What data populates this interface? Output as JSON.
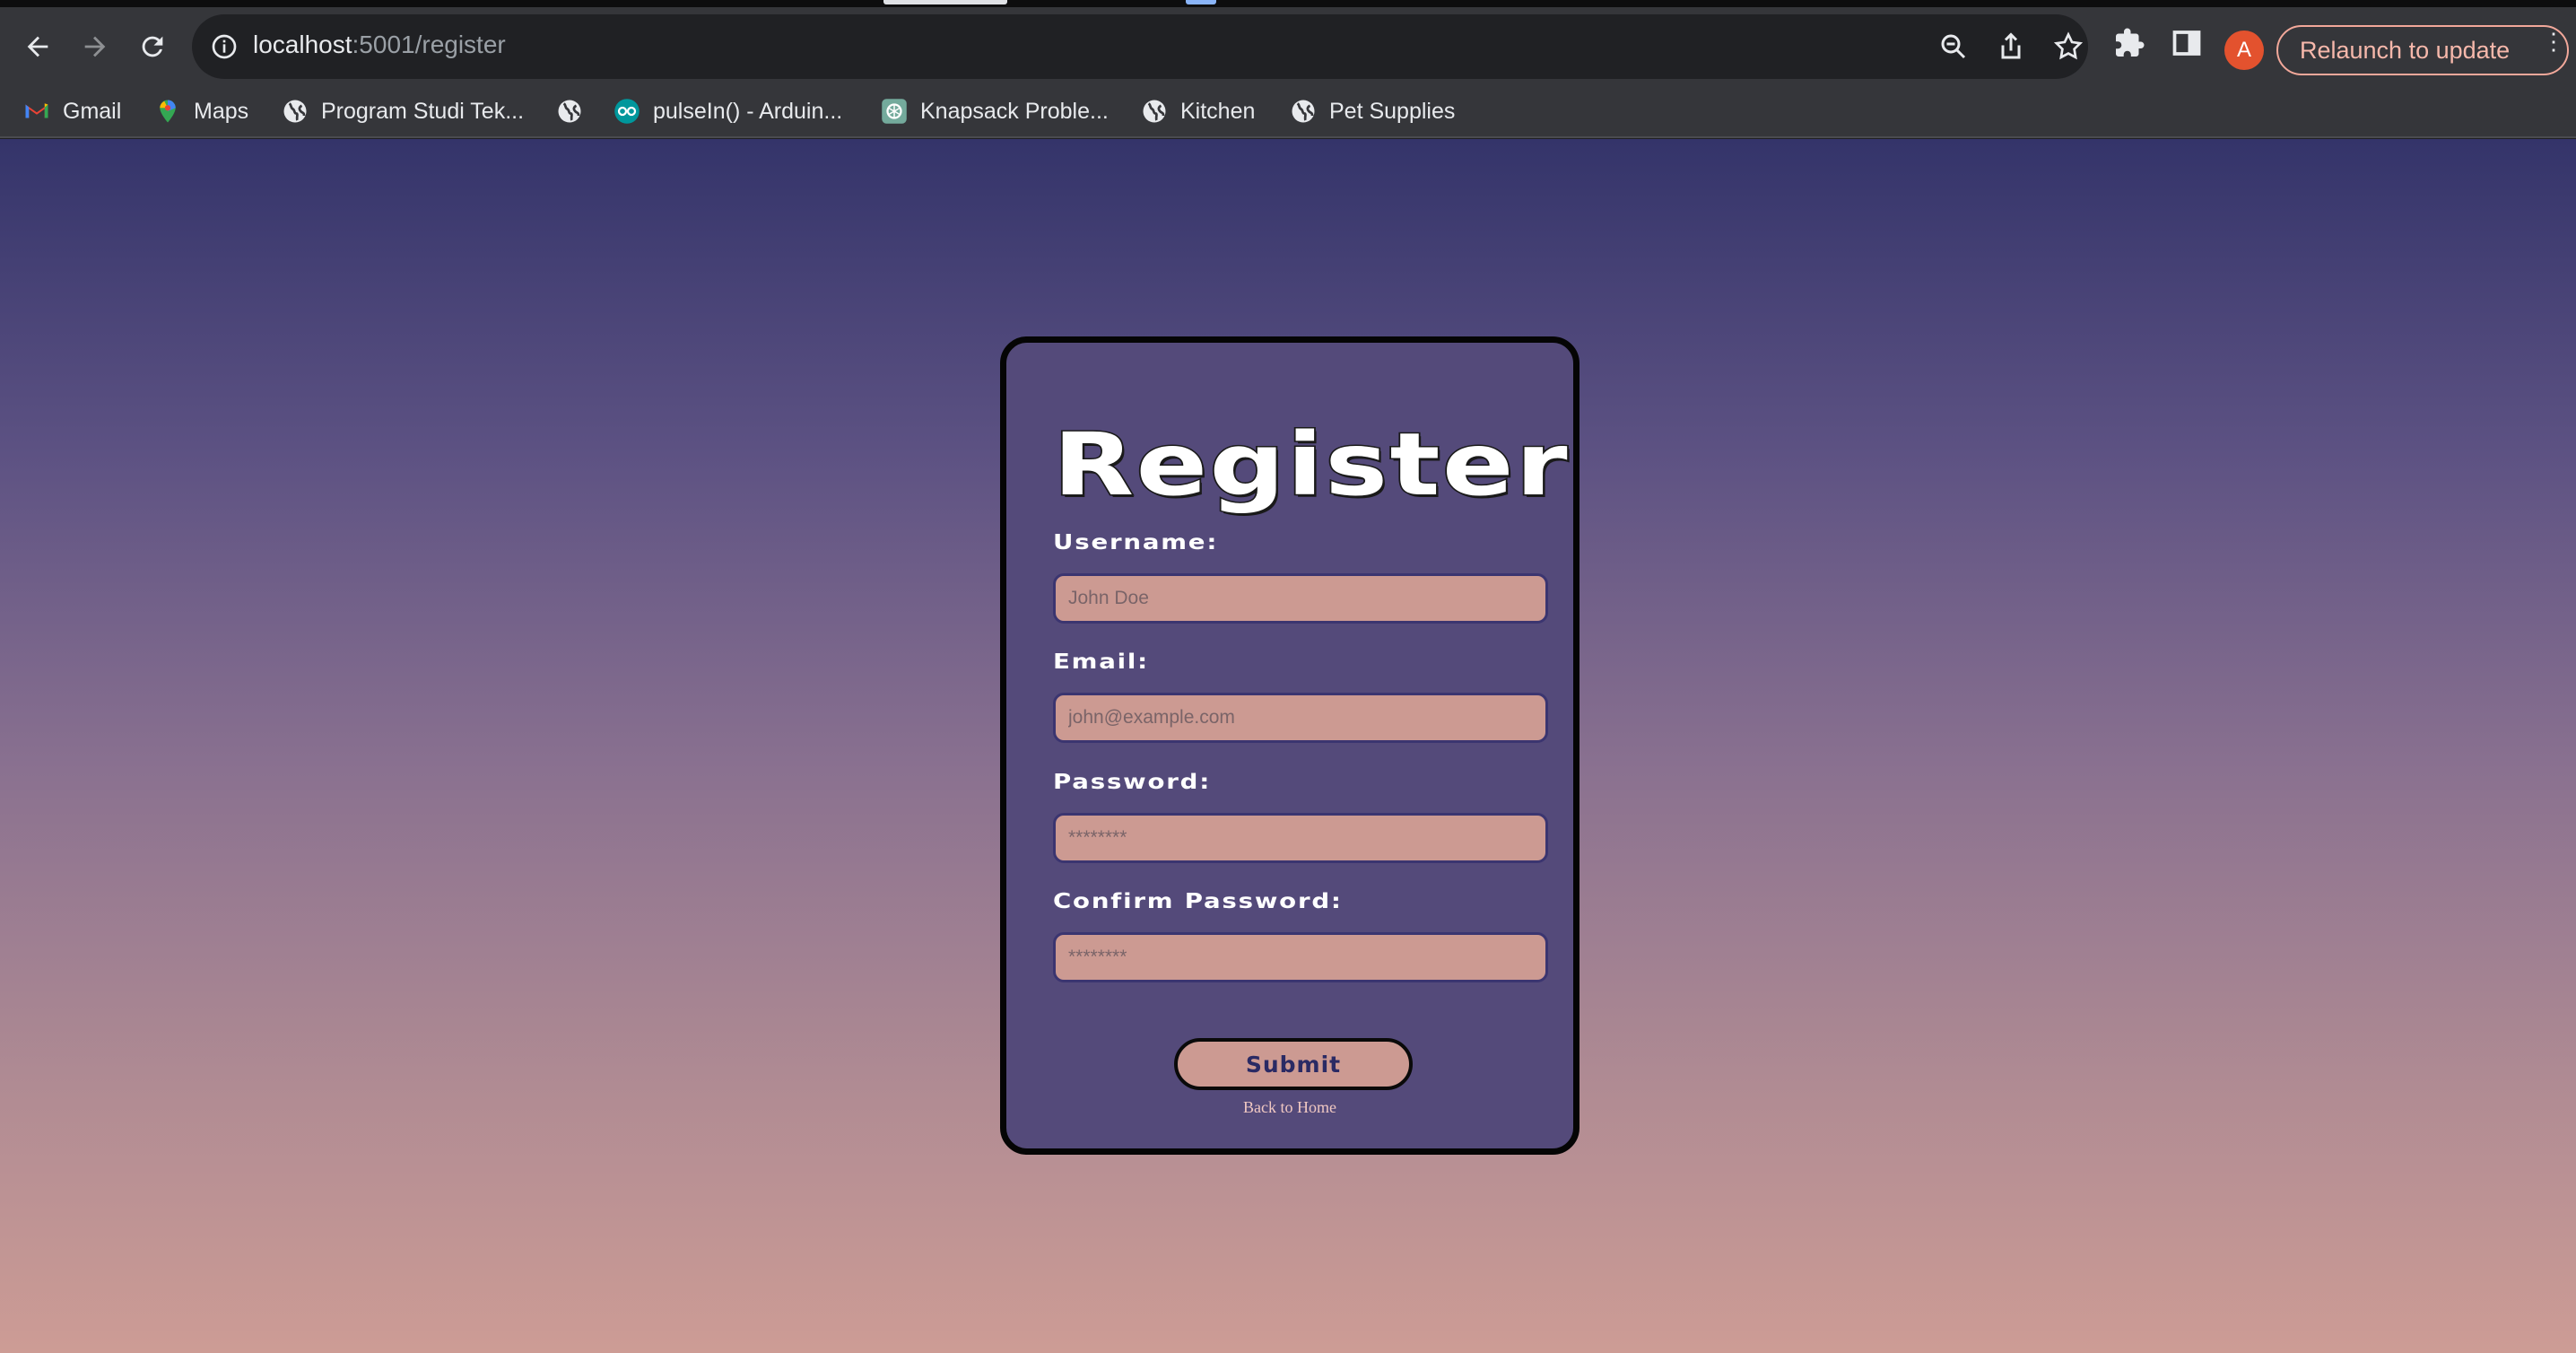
{
  "browser": {
    "url_host": "localhost",
    "url_rest": ":5001/register",
    "avatar_letter": "A",
    "relaunch_label": "Relaunch to update",
    "bookmarks": [
      {
        "label": "Gmail",
        "icon": "gmail-icon"
      },
      {
        "label": "Maps",
        "icon": "maps-icon"
      },
      {
        "label": "Program Studi Tek...",
        "icon": "globe-icon"
      },
      {
        "label": "",
        "icon": "globe-icon"
      },
      {
        "label": "pulseIn() - Arduin...",
        "icon": "arduino-icon"
      },
      {
        "label": "Knapsack Proble...",
        "icon": "chatgpt-icon"
      },
      {
        "label": "Kitchen",
        "icon": "globe-icon"
      },
      {
        "label": "Pet Supplies",
        "icon": "globe-icon"
      }
    ]
  },
  "form": {
    "title": "Register",
    "username_label": "Username:",
    "username_placeholder": "John Doe",
    "email_label": "Email:",
    "email_placeholder": "john@example.com",
    "password_label": "Password:",
    "password_placeholder": "********",
    "confirm_label": "Confirm Password:",
    "confirm_placeholder": "********",
    "submit_label": "Submit",
    "back_link": "Back to Home"
  },
  "colors": {
    "card_bg": "#544a7a",
    "input_bg": "#cc9a92",
    "gradient_top": "#34346a",
    "gradient_bottom": "#cd9c95"
  }
}
